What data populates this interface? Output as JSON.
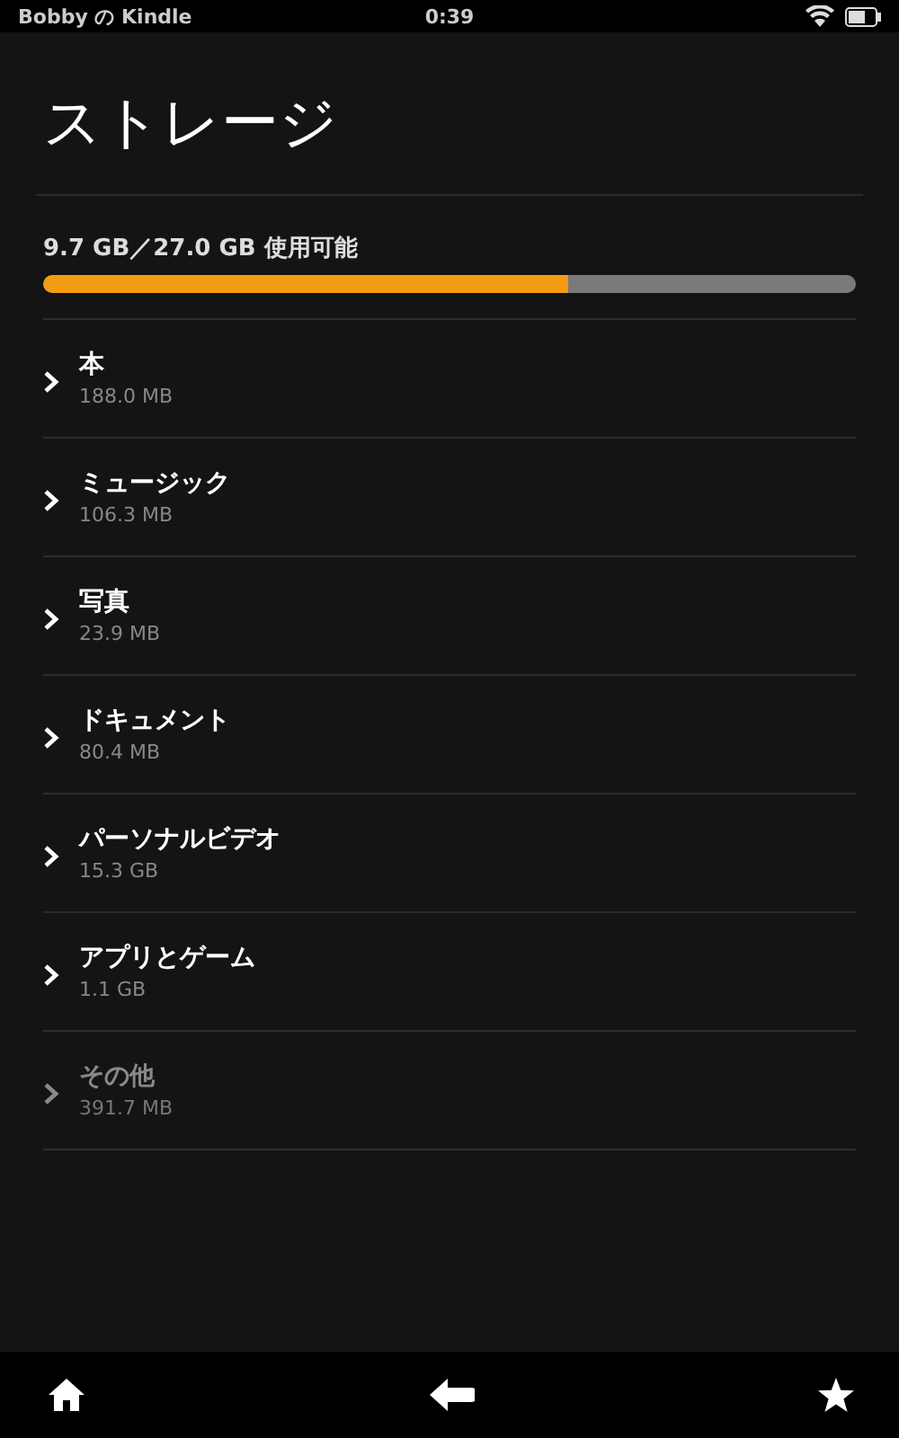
{
  "status_bar": {
    "device_name": "Bobby の Kindle",
    "time": "0:39"
  },
  "title": "ストレージ",
  "storage": {
    "summary": "9.7 GB／27.0 GB 使用可能",
    "level": 0.645
  },
  "categories": [
    {
      "name": "本",
      "size": "188.0 MB",
      "disabled": false
    },
    {
      "name": "ミュージック",
      "size": "106.3 MB",
      "disabled": false
    },
    {
      "name": "写真",
      "size": "23.9 MB",
      "disabled": false
    },
    {
      "name": "ドキュメント",
      "size": "80.4 MB",
      "disabled": false
    },
    {
      "name": "パーソナルビデオ",
      "size": "15.3 GB",
      "disabled": false
    },
    {
      "name": "アプリとゲーム",
      "size": "1.1 GB",
      "disabled": false
    },
    {
      "name": "その他",
      "size": "391.7 MB",
      "disabled": true
    }
  ]
}
